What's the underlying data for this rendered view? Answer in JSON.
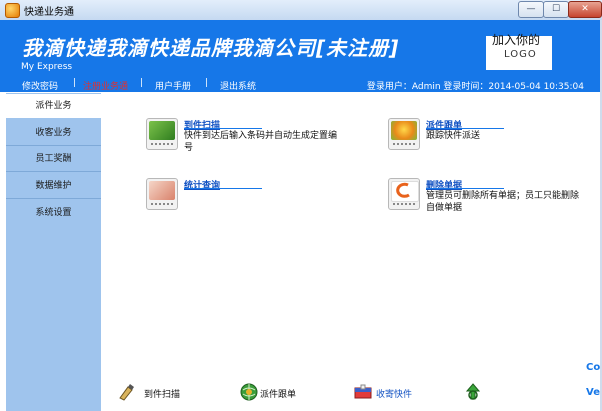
{
  "window": {
    "title": "快递业务通",
    "min_label": "—",
    "max_label": "☐",
    "close_label": "✕"
  },
  "header": {
    "brand": "我滴快递我滴快递品牌我滴公司[未注册]",
    "subbrand": "My Express",
    "logo_text": "加入你的",
    "logo_sub": "LOGO",
    "nav": [
      {
        "label": "修改密码"
      },
      {
        "label": "注册业务通"
      },
      {
        "label": "用户手册"
      },
      {
        "label": "退出系统"
      }
    ],
    "nav_sep": "|",
    "login_info": "登录用户：Admin  登录时间：2014-05-04 10:35:04"
  },
  "sidebar": {
    "items": [
      {
        "label": "派件业务"
      },
      {
        "label": "收客业务"
      },
      {
        "label": "员工奖酬"
      },
      {
        "label": "数据维护"
      },
      {
        "label": "系统设置"
      }
    ]
  },
  "cards": [
    {
      "title": "到件扫描",
      "desc": "快件到达后输入条码并自动生成定置编号"
    },
    {
      "title": "派件跟单",
      "desc": "跟踪快件派送"
    },
    {
      "title": "统计查询",
      "desc": ""
    },
    {
      "title": "删除单据",
      "desc": "管理员可删除所有单据；员工只能删除自做单据"
    }
  ],
  "toolbar": [
    {
      "label": "到件扫描",
      "icon": "scanner-icon"
    },
    {
      "label": "派件跟单",
      "icon": "globe-icon"
    },
    {
      "label": "收寄快件",
      "icon": "package-icon"
    },
    {
      "label": "",
      "icon": "recycle-icon"
    }
  ],
  "edge_text": {
    "top": "Co",
    "bottom": "Ve"
  },
  "colors": {
    "header_blue": "#1677e8",
    "sidebar_blue": "#9fc4ed",
    "active_nav_red": "#e03030",
    "link_blue": "#1151c2"
  }
}
